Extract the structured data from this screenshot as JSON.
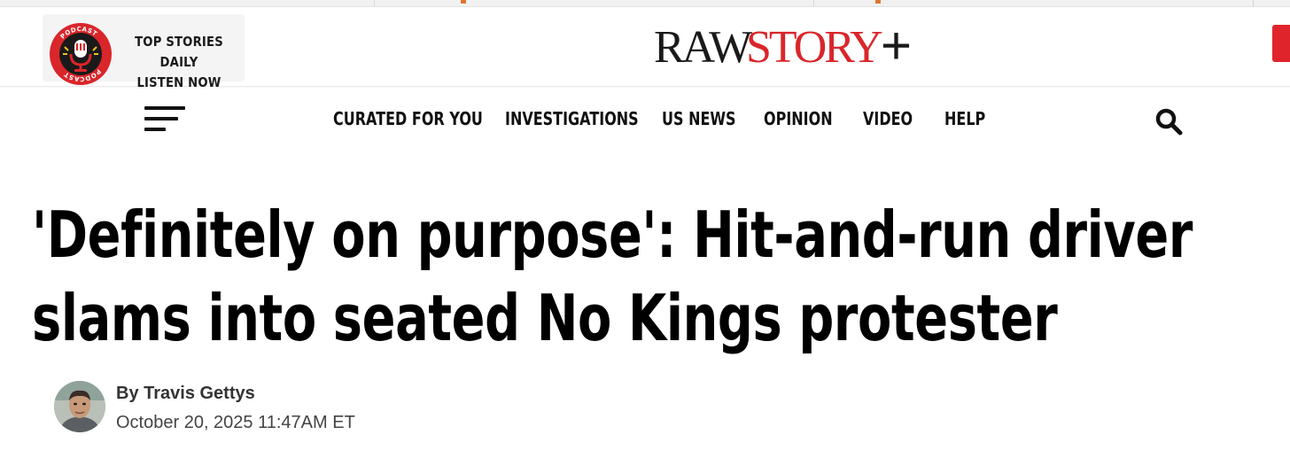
{
  "colors": {
    "accent_red": "#d9262b",
    "text_dark": "#111111",
    "podcast_bg": "#f4f4f4"
  },
  "podcast": {
    "badge_text": "PODCAST",
    "line1": "TOP STORIES DAILY",
    "line2": "LISTEN NOW",
    "icon": "microphone-icon"
  },
  "logo": {
    "raw": "RAW",
    "story": "STORY",
    "plus": "+"
  },
  "nav": {
    "menu_icon": "hamburger-icon",
    "items": [
      "CURATED FOR YOU",
      "INVESTIGATIONS",
      "US NEWS",
      "OPINION",
      "VIDEO",
      "HELP"
    ],
    "search_icon": "search-icon"
  },
  "article": {
    "headline_line1": "'Definitely on purpose': Hit-and-run driver",
    "headline_line2": "slams into seated No Kings protester",
    "author": "By Travis Gettys",
    "date": "October 20, 2025 11:47AM ET"
  }
}
